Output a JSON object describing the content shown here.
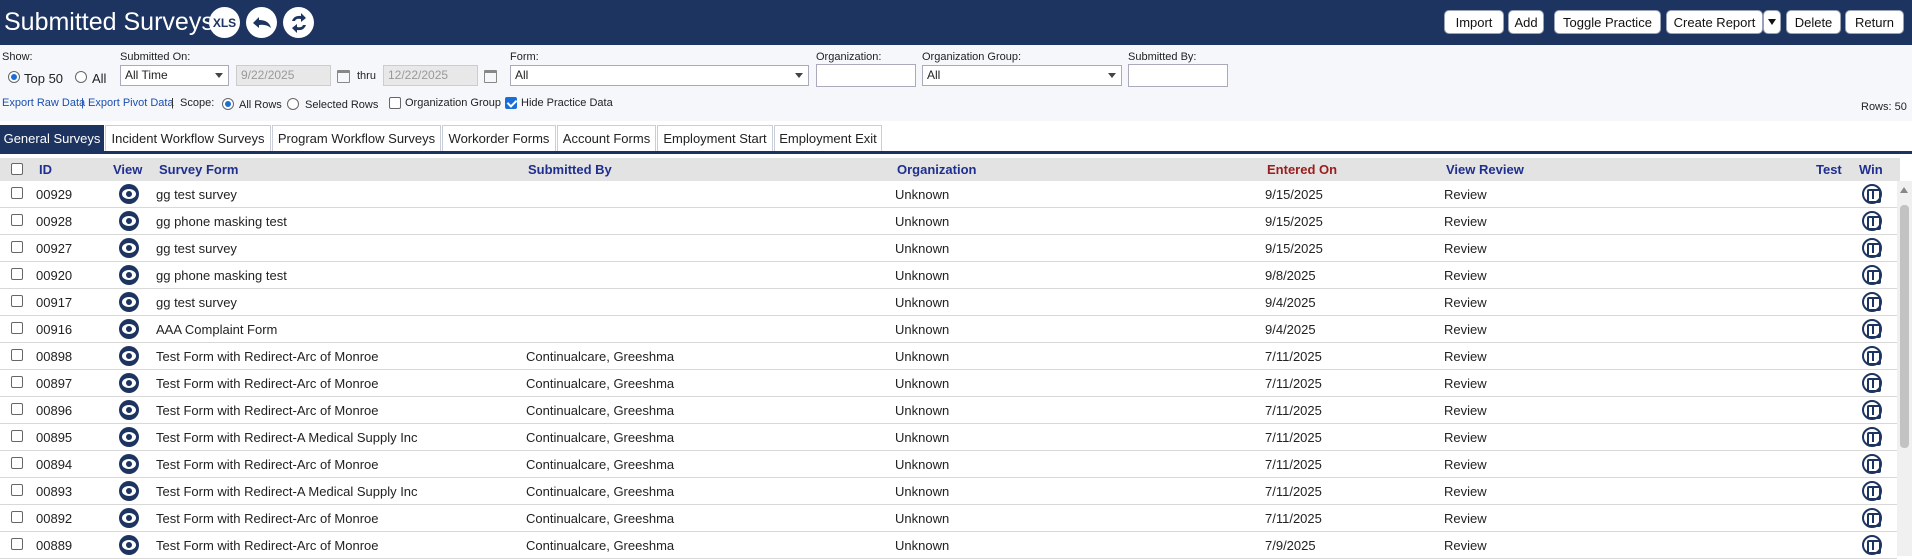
{
  "header": {
    "title": "Submitted Surveys",
    "xls_label": "XLS",
    "buttons": {
      "import": "Import",
      "add": "Add",
      "toggle_practice": "Toggle Practice",
      "create_report": "Create Report",
      "delete": "Delete",
      "return": "Return"
    }
  },
  "filters": {
    "show_label": "Show:",
    "top50_label": "Top 50",
    "all_label": "All",
    "submitted_on_label": "Submitted On:",
    "submitted_on_value": "All Time",
    "date_from": "9/22/2025",
    "thru_label": "thru",
    "date_to": "12/22/2025",
    "form_label": "Form:",
    "form_value": "All",
    "organization_label": "Organization:",
    "organization_value": "",
    "org_group_label": "Organization Group:",
    "org_group_value": "All",
    "submitted_by_label": "Submitted By:",
    "submitted_by_value": "",
    "export_raw": "Export Raw Data",
    "export_pivot": "Export Pivot Data",
    "scope_label": "Scope:",
    "all_rows": "All Rows",
    "selected_rows": "Selected Rows",
    "org_group_check": "Organization Group",
    "hide_practice": "Hide Practice Data",
    "rows_count": "Rows: 50"
  },
  "tabs": [
    "General Surveys",
    "Incident Workflow Surveys",
    "Program Workflow Surveys",
    "Workorder Forms",
    "Account Forms",
    "Employment Start",
    "Employment Exit"
  ],
  "table": {
    "headers": {
      "id": "ID",
      "view": "View",
      "survey_form": "Survey Form",
      "submitted_by": "Submitted By",
      "organization": "Organization",
      "entered_on": "Entered On",
      "view_review": "View Review",
      "test": "Test",
      "win": "Win"
    },
    "rows": [
      {
        "id": "00929",
        "form": "gg test survey",
        "by": "",
        "org": "Unknown",
        "date": "9/15/2025",
        "review": "Review"
      },
      {
        "id": "00928",
        "form": "gg phone masking test",
        "by": "",
        "org": "Unknown",
        "date": "9/15/2025",
        "review": "Review"
      },
      {
        "id": "00927",
        "form": "gg test survey",
        "by": "",
        "org": "Unknown",
        "date": "9/15/2025",
        "review": "Review"
      },
      {
        "id": "00920",
        "form": "gg phone masking test",
        "by": "",
        "org": "Unknown",
        "date": "9/8/2025",
        "review": "Review"
      },
      {
        "id": "00917",
        "form": "gg test survey",
        "by": "",
        "org": "Unknown",
        "date": "9/4/2025",
        "review": "Review"
      },
      {
        "id": "00916",
        "form": "AAA Complaint Form",
        "by": "",
        "org": "Unknown",
        "date": "9/4/2025",
        "review": "Review"
      },
      {
        "id": "00898",
        "form": "Test Form with Redirect-Arc of Monroe",
        "by": "Continualcare, Greeshma",
        "org": "Unknown",
        "date": "7/11/2025",
        "review": "Review"
      },
      {
        "id": "00897",
        "form": "Test Form with Redirect-Arc of Monroe",
        "by": "Continualcare, Greeshma",
        "org": "Unknown",
        "date": "7/11/2025",
        "review": "Review"
      },
      {
        "id": "00896",
        "form": "Test Form with Redirect-Arc of Monroe",
        "by": "Continualcare, Greeshma",
        "org": "Unknown",
        "date": "7/11/2025",
        "review": "Review"
      },
      {
        "id": "00895",
        "form": "Test Form with Redirect-A Medical Supply Inc",
        "by": "Continualcare, Greeshma",
        "org": "Unknown",
        "date": "7/11/2025",
        "review": "Review"
      },
      {
        "id": "00894",
        "form": "Test Form with Redirect-Arc of Monroe",
        "by": "Continualcare, Greeshma",
        "org": "Unknown",
        "date": "7/11/2025",
        "review": "Review"
      },
      {
        "id": "00893",
        "form": "Test Form with Redirect-A Medical Supply Inc",
        "by": "Continualcare, Greeshma",
        "org": "Unknown",
        "date": "7/11/2025",
        "review": "Review"
      },
      {
        "id": "00892",
        "form": "Test Form with Redirect-Arc of Monroe",
        "by": "Continualcare, Greeshma",
        "org": "Unknown",
        "date": "7/11/2025",
        "review": "Review"
      },
      {
        "id": "00889",
        "form": "Test Form with Redirect-Arc of Monroe",
        "by": "Continualcare, Greeshma",
        "org": "Unknown",
        "date": "7/9/2025",
        "review": "Review"
      }
    ]
  }
}
